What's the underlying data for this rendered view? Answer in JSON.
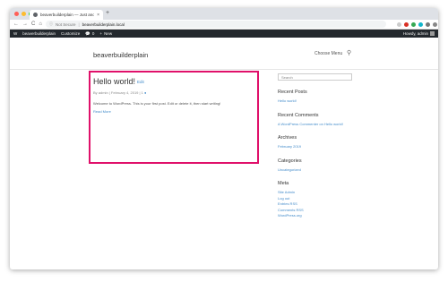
{
  "browser": {
    "tab_title": "beaverbuilderplain — Just ano...",
    "tab_close": "×",
    "new_tab": "+",
    "nav_back": "←",
    "nav_forward": "→",
    "nav_reload": "C",
    "nav_home": "⌂",
    "omnibox_lock": "ⓘ",
    "omnibox_secure": "Not Secure",
    "omnibox_sep": "|",
    "omnibox_url": "beaverbuilderplain.local",
    "colors": {
      "close": "#ff5f57",
      "minimize": "#febc2e",
      "maximize": "#28c840"
    }
  },
  "adminbar": {
    "wp_icon": "W",
    "site_name": "beaverbuilderplain",
    "customize": "Customize",
    "comments_icon": "💬",
    "comments_count": "0",
    "new_icon": "+",
    "new_label": "New",
    "howdy": "Howdy, admin"
  },
  "header": {
    "site_title": "beaverbuilderplain",
    "menu_label": "Choose Menu",
    "search_icon": "⚲"
  },
  "post": {
    "title": "Hello world!",
    "edit_label": "Edit",
    "meta": "By admin | February 4, 2019 | 1",
    "comment_icon": "●",
    "body": "Welcome to WordPress. This is your first post. Edit or delete it, then start writing!",
    "read_more": "Read More"
  },
  "sidebar": {
    "search_placeholder": "Search",
    "recent_posts_title": "Recent Posts",
    "recent_posts": [
      "Hello world!"
    ],
    "recent_comments_title": "Recent Comments",
    "recent_comments": [
      "A WordPress Commenter on Hello world!"
    ],
    "archives_title": "Archives",
    "archives": [
      "February 2019"
    ],
    "categories_title": "Categories",
    "categories": [
      "Uncategorized"
    ],
    "meta_title": "Meta",
    "meta_links": [
      "Site Admin",
      "Log out",
      "Entries RSS",
      "Comments RSS",
      "WordPress.org"
    ]
  }
}
